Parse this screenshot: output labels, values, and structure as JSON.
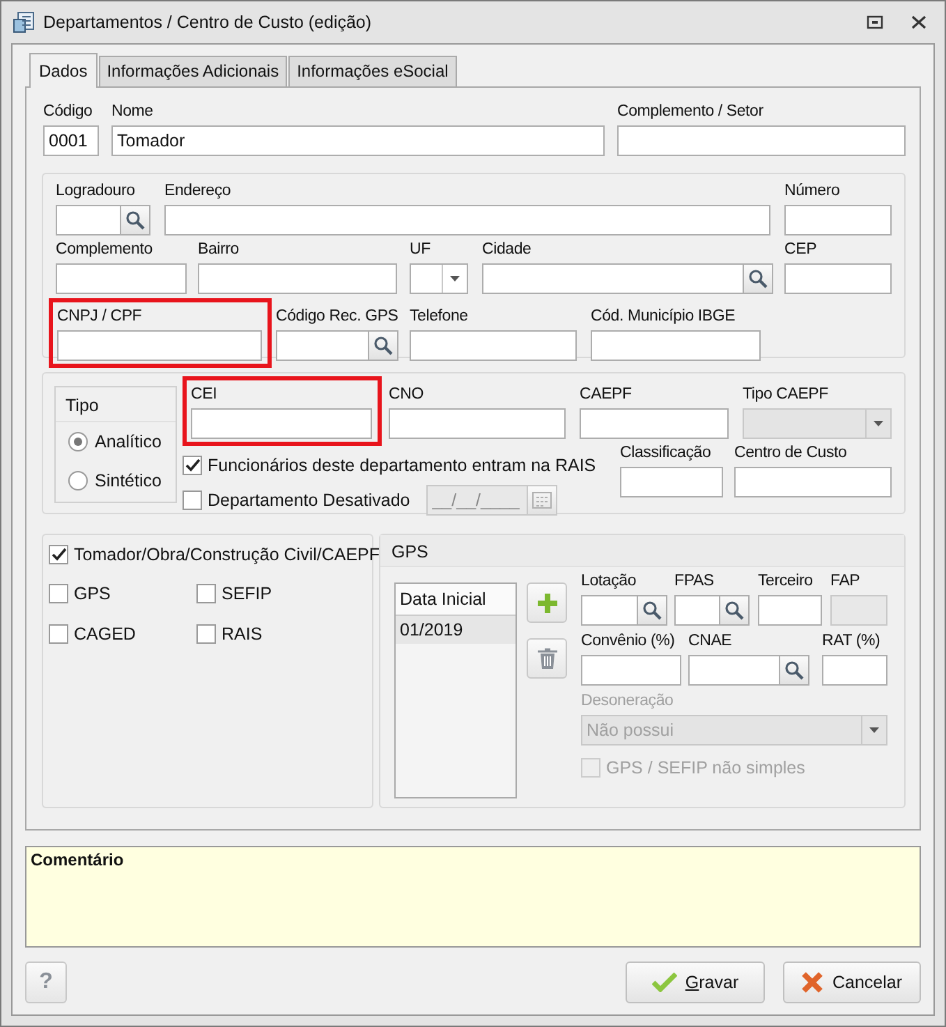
{
  "window": {
    "title": "Departamentos / Centro de Custo (edição)"
  },
  "tabs": [
    {
      "label": "Dados",
      "selected": true
    },
    {
      "label": "Informações Adicionais",
      "selected": false
    },
    {
      "label": "Informações eSocial",
      "selected": false
    }
  ],
  "main_fields": [
    {
      "label": "Código",
      "value": "0001",
      "kind": "text"
    },
    {
      "label": "Nome",
      "value": "Tomador",
      "kind": "text"
    },
    {
      "label": "Complemento / Setor",
      "kind": "text"
    }
  ],
  "address_rows": [
    [
      {
        "label": "Logradouro",
        "kind": "search"
      },
      {
        "label": "Endereço",
        "kind": "text"
      },
      {
        "label": "Número",
        "kind": "text"
      }
    ],
    [
      {
        "label": "Complemento",
        "kind": "text"
      },
      {
        "label": "Bairro",
        "kind": "text"
      },
      {
        "label": "UF",
        "kind": "combo"
      },
      {
        "label": "Cidade",
        "kind": "search"
      },
      {
        "label": "CEP",
        "kind": "text"
      }
    ],
    [
      {
        "label": "CNPJ / CPF",
        "kind": "text",
        "highlighted": true
      },
      {
        "label": "Código Rec. GPS",
        "kind": "search",
        "highlighted": false
      },
      {
        "label": "Telefone",
        "kind": "text",
        "highlighted": false
      },
      {
        "label": "Cód. Município IBGE",
        "kind": "text",
        "highlighted": false
      }
    ]
  ],
  "tipo": {
    "title": "Tipo",
    "options": [
      {
        "label": "Analítico",
        "selected": true
      },
      {
        "label": "Sintético",
        "selected": false
      }
    ]
  },
  "id_fields": [
    {
      "label": "CEI",
      "kind": "text",
      "highlighted": true,
      "disabled": false
    },
    {
      "label": "CNO",
      "kind": "text",
      "highlighted": false,
      "disabled": false
    },
    {
      "label": "CAEPF",
      "kind": "text",
      "highlighted": false,
      "disabled": false
    },
    {
      "label": "Tipo CAEPF",
      "kind": "combo",
      "highlighted": false,
      "disabled": true
    }
  ],
  "rais_option": {
    "label": "Funcionários deste departamento entram na RAIS",
    "checked": true
  },
  "inactive_option": {
    "label": "Departamento Desativado",
    "checked": false,
    "date": {
      "placeholder": "__/__/____",
      "disabled": true
    }
  },
  "class_fields": [
    {
      "label": "Classificação",
      "kind": "text"
    },
    {
      "label": "Centro de Custo",
      "kind": "text"
    }
  ],
  "obligations": {
    "main": {
      "label": "Tomador/Obra/Construção Civil/CAEPF",
      "checked": true
    },
    "items": [
      {
        "label": "GPS",
        "checked": false
      },
      {
        "label": "SEFIP",
        "checked": false
      },
      {
        "label": "CAGED",
        "checked": false
      },
      {
        "label": "RAIS",
        "checked": false
      }
    ]
  },
  "gps": {
    "title": "GPS",
    "list": {
      "column": "Data Inicial",
      "rows": [
        {
          "text": "01/2019",
          "selected": true
        }
      ]
    },
    "field_rows": [
      [
        {
          "label": "Lotação",
          "kind": "search",
          "disabled": false
        },
        {
          "label": "FPAS",
          "kind": "search",
          "disabled": false
        },
        {
          "label": "Terceiro",
          "kind": "text",
          "disabled": false
        },
        {
          "label": "FAP",
          "kind": "text",
          "disabled": true
        }
      ],
      [
        {
          "label": "Convênio (%)",
          "kind": "text"
        },
        {
          "label": "CNAE",
          "kind": "search"
        },
        {
          "label": "RAT (%)",
          "kind": "text"
        }
      ]
    ],
    "desoneracao": {
      "label": "Desoneração",
      "value": "Não possui",
      "disabled": true
    },
    "simples": {
      "label": "GPS / SEFIP não simples",
      "checked": false,
      "disabled": true
    }
  },
  "comment": {
    "label": "Comentário"
  },
  "help_button": "?",
  "buttons": [
    {
      "label": "Gravar",
      "kind": "save"
    },
    {
      "label": "Cancelar",
      "kind": "cancel"
    }
  ]
}
